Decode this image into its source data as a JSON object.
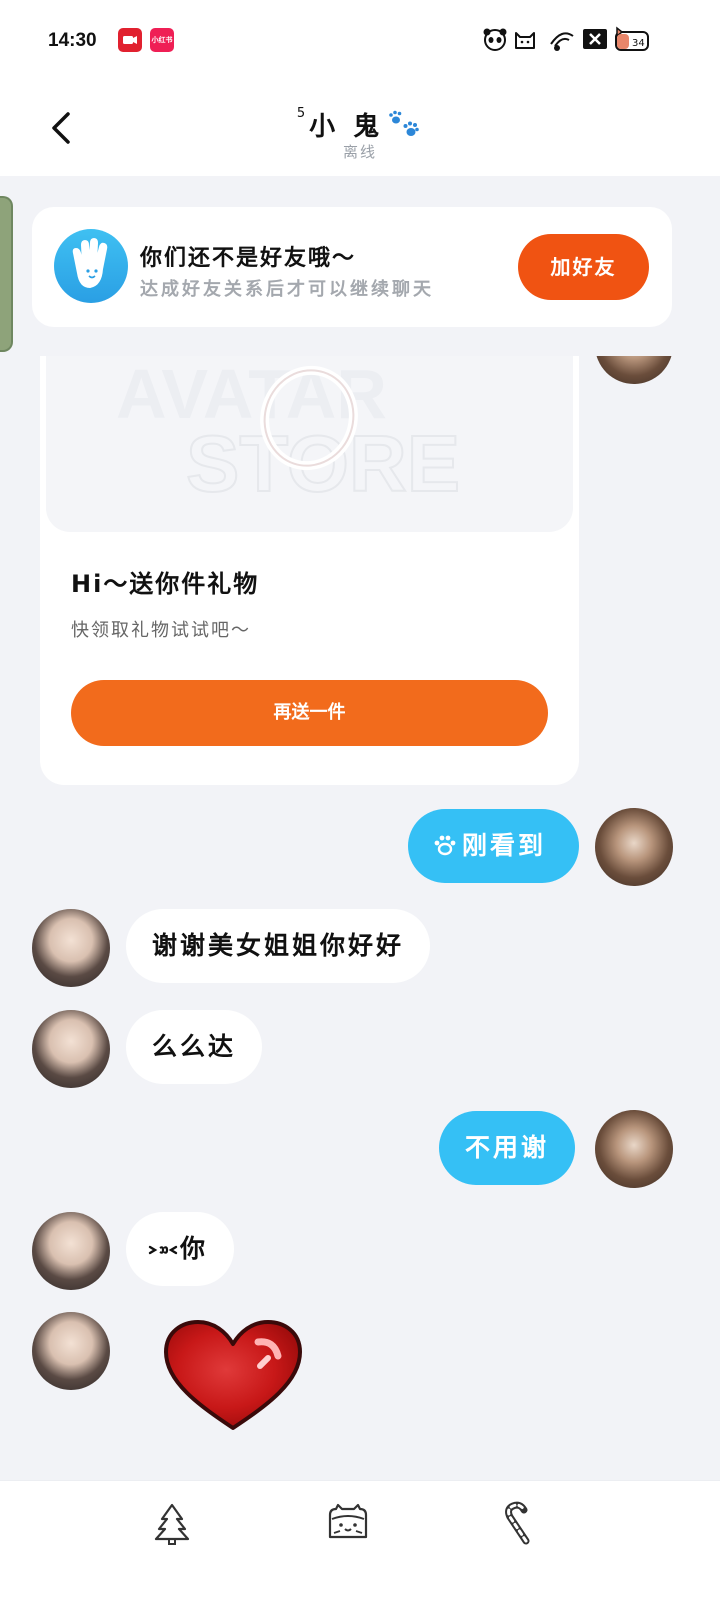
{
  "status_bar": {
    "time": "14:30",
    "app_icons": [
      "video-app-icon",
      "xiaohongshu-app-icon"
    ],
    "app2_label": "小红书",
    "battery": "34",
    "icons": [
      "panda-icon",
      "cat-icon",
      "wifi-icon",
      "close-box-icon",
      "battery-cat-icon"
    ]
  },
  "header": {
    "back_icon": "chevron-left-icon",
    "title_sup": "5",
    "title": "小鬼",
    "title_icon": "paw-prints-icon",
    "subtitle": "离线"
  },
  "friend_banner": {
    "avatar_icon": "hand-wave-icon",
    "title": "你们还不是好友哦～",
    "subtitle": "达成好友关系后才可以继续聊天",
    "button": "加好友"
  },
  "gift_card": {
    "image_watermark_top": "AVATAR",
    "image_watermark_bottom": "STORE",
    "title": "Hi～送你件礼物",
    "subtitle": "快领取礼物试试吧～",
    "button": "再送一件"
  },
  "messages": [
    {
      "side": "out",
      "text": "刚看到",
      "icon": "paw-icon"
    },
    {
      "side": "in",
      "text": "谢谢美女姐姐你好好"
    },
    {
      "side": "in",
      "text": "么么达"
    },
    {
      "side": "out",
      "text": "不用谢"
    },
    {
      "side": "in",
      "text": "你",
      "prefix_icon": "kiss-emoji-icon"
    },
    {
      "side": "in",
      "sticker": "heart-sticker-icon"
    }
  ],
  "bottom_bar": {
    "icons": [
      "christmas-tree-icon",
      "cat-loaf-icon",
      "candy-cane-icon"
    ]
  },
  "colors": {
    "accent_orange": "#f05312",
    "gift_button": "#f26b1c",
    "bubble_out": "#35c0f5",
    "background": "#f2f3f7"
  }
}
